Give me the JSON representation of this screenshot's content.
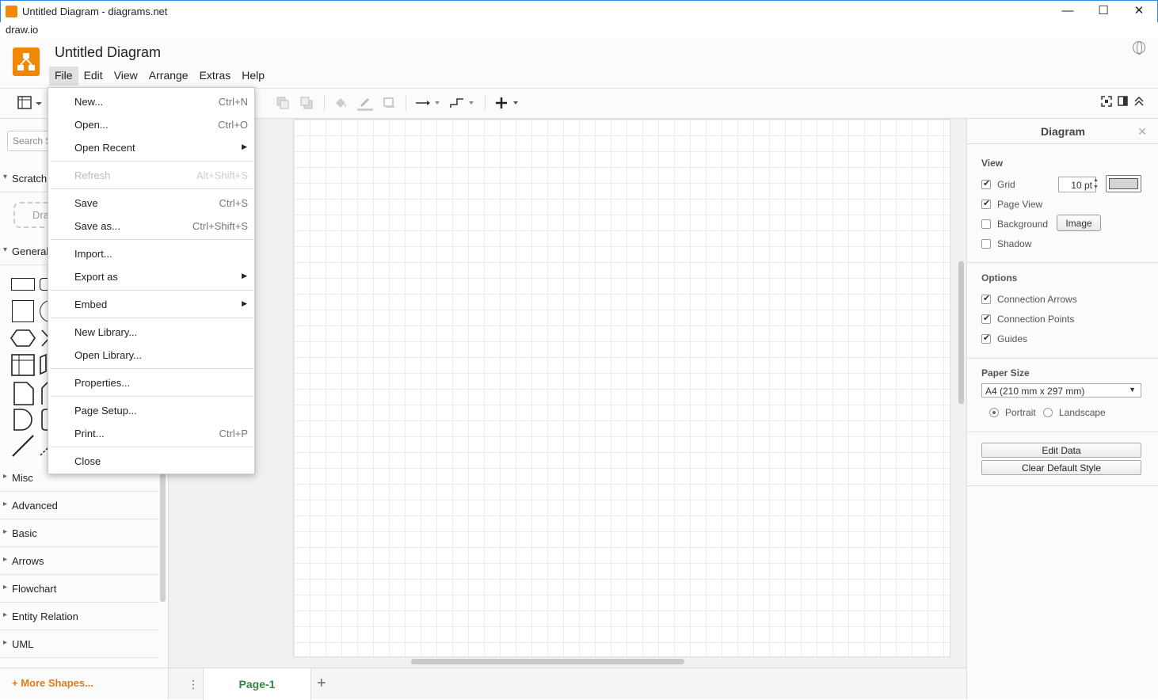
{
  "window": {
    "title": "Untitled Diagram - diagrams.net",
    "minimize": "—",
    "maximize": "☐",
    "close": "✕"
  },
  "app_label": "draw.io",
  "doc_title": "Untitled Diagram",
  "menus": [
    "File",
    "Edit",
    "View",
    "Arrange",
    "Extras",
    "Help"
  ],
  "file_menu": {
    "new": "New...",
    "new_sc": "Ctrl+N",
    "open": "Open...",
    "open_sc": "Ctrl+O",
    "open_recent": "Open Recent",
    "refresh": "Refresh",
    "refresh_sc": "Alt+Shift+S",
    "save": "Save",
    "save_sc": "Ctrl+S",
    "save_as": "Save as...",
    "save_as_sc": "Ctrl+Shift+S",
    "import": "Import...",
    "export_as": "Export as",
    "embed": "Embed",
    "new_library": "New Library...",
    "open_library": "Open Library...",
    "properties": "Properties...",
    "page_setup": "Page Setup...",
    "print": "Print...",
    "print_sc": "Ctrl+P",
    "close": "Close"
  },
  "sidebar": {
    "search_placeholder": "Search S",
    "scratchpad": "Scratch",
    "drop_text": "Dra",
    "general": "General",
    "sections": [
      "Misc",
      "Advanced",
      "Basic",
      "Arrows",
      "Flowchart",
      "Entity Relation",
      "UML"
    ],
    "more_shapes": "More Shapes..."
  },
  "page_tab": "Page-1",
  "format_panel": {
    "title": "Diagram",
    "view_header": "View",
    "grid": "Grid",
    "grid_checked": true,
    "grid_size": "10 pt",
    "page_view": "Page View",
    "page_view_checked": true,
    "background": "Background",
    "background_checked": false,
    "image_button": "Image",
    "shadow": "Shadow",
    "shadow_checked": false,
    "options_header": "Options",
    "connection_arrows": "Connection Arrows",
    "connection_points": "Connection Points",
    "guides": "Guides",
    "paper_size_header": "Paper Size",
    "paper_size": "A4 (210 mm x 297 mm)",
    "portrait": "Portrait",
    "landscape": "Landscape",
    "orientation": "Portrait",
    "edit_data": "Edit Data",
    "clear_default_style": "Clear Default Style"
  },
  "colors": {
    "accent": "#f08705",
    "page_tab_text": "#2e8540",
    "more_shapes": "#e07a17"
  }
}
